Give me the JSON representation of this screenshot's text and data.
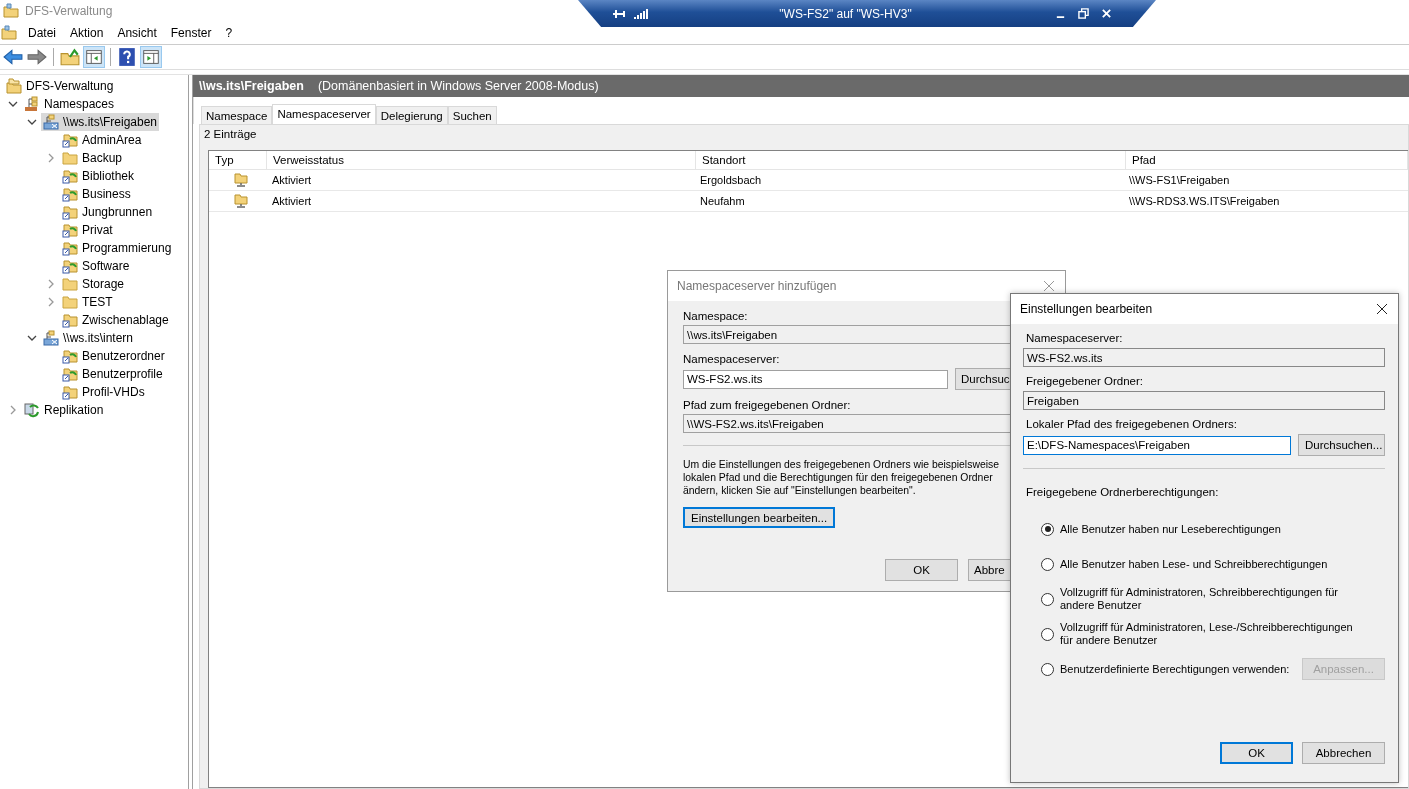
{
  "window": {
    "title": "DFS-Verwaltung"
  },
  "remote_bar": {
    "title": "\"WS-FS2\" auf \"WS-HV3\""
  },
  "menu": [
    "Datei",
    "Aktion",
    "Ansicht",
    "Fenster",
    "?"
  ],
  "toolbar": {
    "tree_pane_pressed": true,
    "action_pane_pressed": true
  },
  "tree": [
    {
      "label": "DFS-Verwaltung",
      "kind": "root",
      "selected": false,
      "children": [
        {
          "label": "Namespaces",
          "kind": "namespaces",
          "expanded": true,
          "selected": false,
          "children": [
            {
              "label": "\\\\ws.its\\Freigaben",
              "kind": "namespace",
              "expanded": true,
              "selected": true,
              "children": [
                {
                  "label": "AdminArea",
                  "kind": "target",
                  "selected": false
                },
                {
                  "label": "Backup",
                  "kind": "folder",
                  "expanded": false,
                  "selected": false
                },
                {
                  "label": "Bibliothek",
                  "kind": "target",
                  "selected": false
                },
                {
                  "label": "Business",
                  "kind": "target",
                  "selected": false
                },
                {
                  "label": "Jungbrunnen",
                  "kind": "link",
                  "selected": false
                },
                {
                  "label": "Privat",
                  "kind": "target",
                  "selected": false
                },
                {
                  "label": "Programmierung",
                  "kind": "target",
                  "selected": false
                },
                {
                  "label": "Software",
                  "kind": "target",
                  "selected": false
                },
                {
                  "label": "Storage",
                  "kind": "folder",
                  "expanded": false,
                  "selected": false
                },
                {
                  "label": "TEST",
                  "kind": "folder",
                  "expanded": false,
                  "selected": false
                },
                {
                  "label": "Zwischenablage",
                  "kind": "link",
                  "selected": false
                }
              ]
            },
            {
              "label": "\\\\ws.its\\intern",
              "kind": "namespace",
              "expanded": true,
              "selected": false,
              "children": [
                {
                  "label": "Benutzerordner",
                  "kind": "target",
                  "selected": false
                },
                {
                  "label": "Benutzerprofile",
                  "kind": "target",
                  "selected": false
                },
                {
                  "label": "Profil-VHDs",
                  "kind": "link",
                  "selected": false
                }
              ]
            }
          ]
        },
        {
          "label": "Replikation",
          "kind": "replication",
          "expanded": false,
          "selected": false
        }
      ]
    }
  ],
  "header": {
    "title": "\\\\ws.its\\Freigaben",
    "subtitle": "(Domänenbasiert in Windows Server 2008-Modus)"
  },
  "tabs": [
    {
      "label": "Namespace",
      "selected": false
    },
    {
      "label": "Namespaceserver",
      "selected": true
    },
    {
      "label": "Delegierung",
      "selected": false
    },
    {
      "label": "Suchen",
      "selected": false
    }
  ],
  "count": "2 Einträge",
  "table": {
    "columns": [
      "Typ",
      "Verweisstatus",
      "Standort",
      "Pfad"
    ],
    "rows": [
      {
        "status": "Aktiviert",
        "location": "Ergoldsbach",
        "path": "\\\\WS-FS1\\Freigaben"
      },
      {
        "status": "Aktiviert",
        "location": "Neufahm",
        "path": "\\\\WS-RDS3.WS.ITS\\Freigaben"
      }
    ]
  },
  "add_dialog": {
    "title": "Namespaceserver hinzufügen",
    "namespace_label": "Namespace:",
    "namespace": "\\\\ws.its\\Freigaben",
    "server_label": "Namespaceserver:",
    "server": "WS-FS2.ws.its",
    "browse": "Durchsuc",
    "path_label": "Pfad zum freigegebenen Ordner:",
    "path": "\\\\WS-FS2.ws.its\\Freigaben",
    "info_lines": [
      "Um die Einstellungen des freigegebenen Ordners wie beispielsweise",
      "lokalen Pfad und die Berechtigungen für den freigegebenen Ordner",
      "ändern, klicken Sie auf \"Einstellungen bearbeiten\"."
    ],
    "edit_button": "Einstellungen bearbeiten...",
    "ok": "OK",
    "cancel": "Abbre"
  },
  "edit_dialog": {
    "title": "Einstellungen bearbeiten",
    "server_label": "Namespaceserver:",
    "server": "WS-FS2.ws.its",
    "share_label": "Freigegebener Ordner:",
    "share": "Freigaben",
    "local_label": "Lokaler Pfad des freigegebenen Ordners:",
    "local": "E:\\DFS-Namespaces\\Freigaben",
    "browse": "Durchsuchen...",
    "perm_label": "Freigegebene Ordnerberechtigungen:",
    "options": [
      {
        "label": "Alle Benutzer haben nur Leseberechtigungen",
        "selected": true
      },
      {
        "label": "Alle Benutzer haben Lese- und Schreibberechtigungen",
        "selected": false
      },
      {
        "label": "Vollzugriff für Administratoren, Schreibberechtigungen für andere Benutzer",
        "selected": false
      },
      {
        "label": "Vollzugriff für Administratoren, Lese-/Schreibberechtigungen für andere Benutzer",
        "selected": false
      },
      {
        "label": "Benutzerdefinierte Berechtigungen verwenden:",
        "selected": false,
        "button": {
          "label": "Anpassen...",
          "disabled": true
        }
      }
    ],
    "ok": "OK",
    "cancel": "Abbrechen"
  }
}
